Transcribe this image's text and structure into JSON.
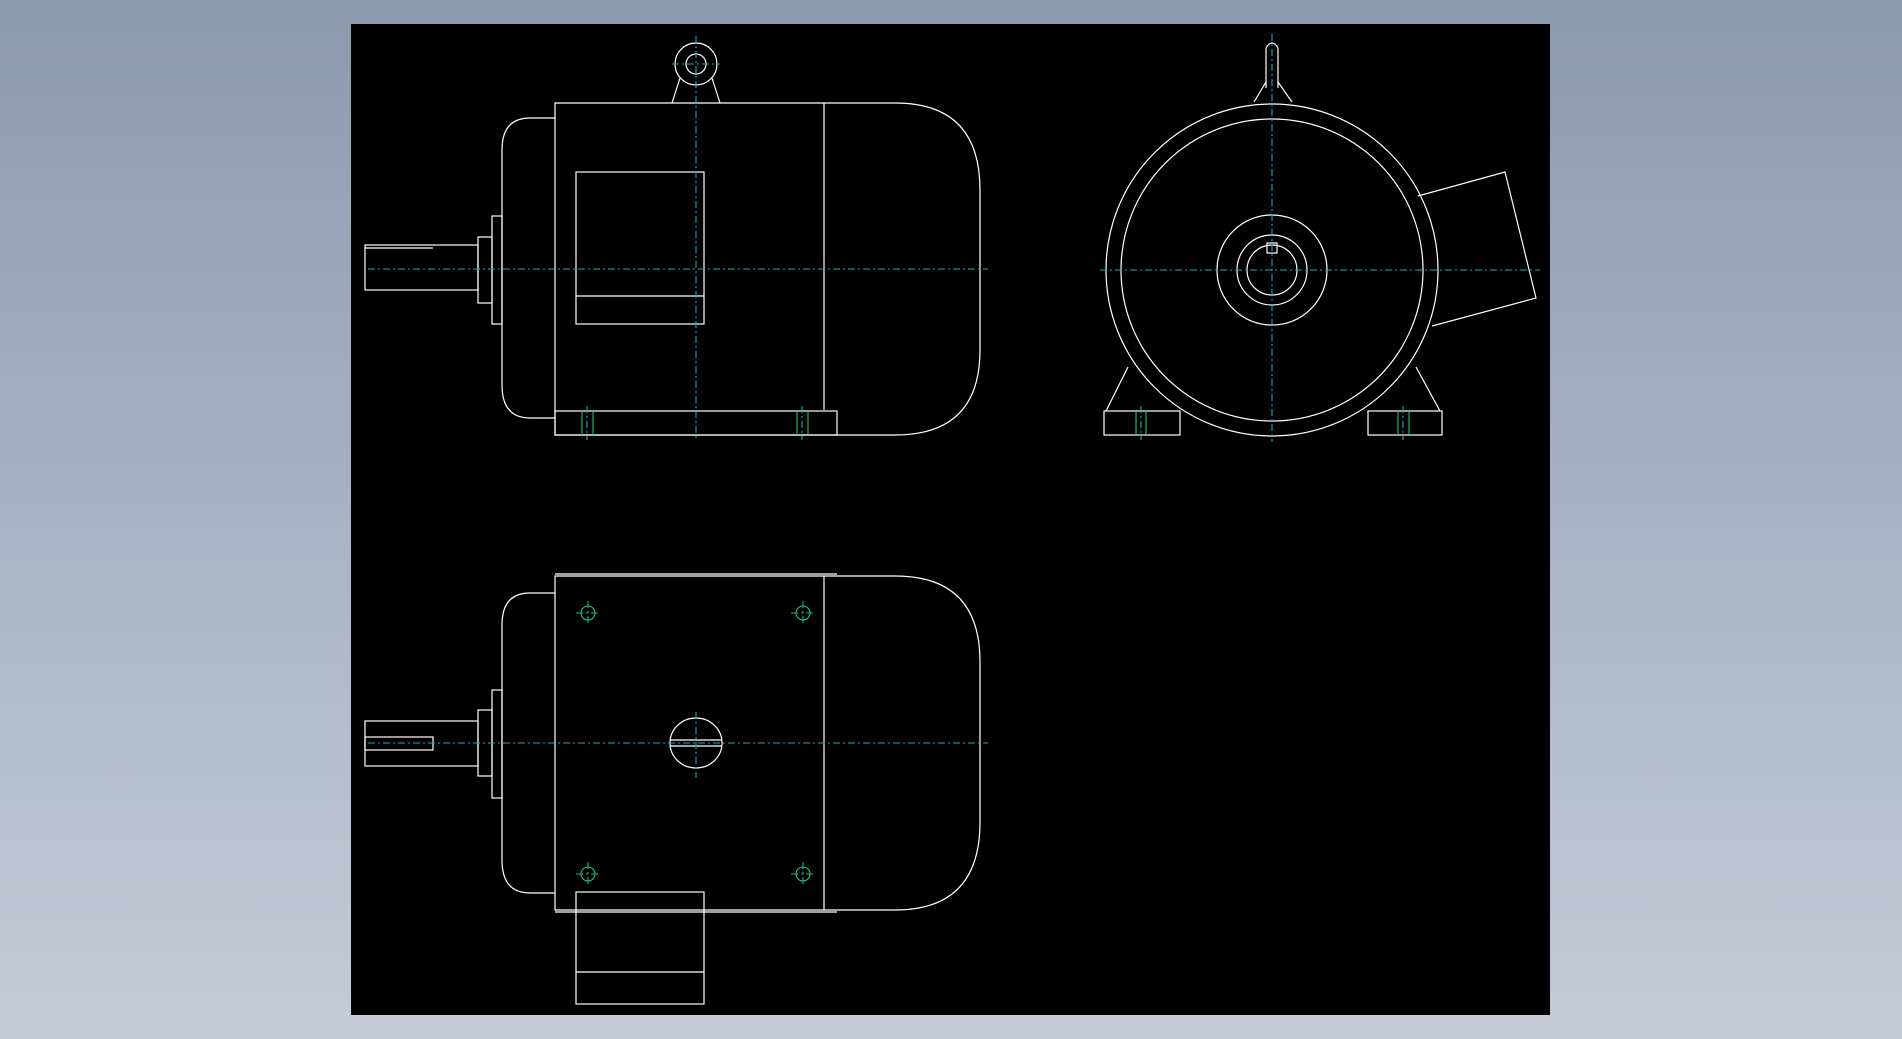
{
  "colors": {
    "background_top": "#8c9aae",
    "background_bottom": "#c6cbd8",
    "drawing_background": "#000000",
    "geometry_lines": "#ffffff",
    "center_lines": "#13b0b0",
    "hole_markers": "#22c46a"
  },
  "views": [
    "front-view",
    "side-view",
    "top-view"
  ]
}
